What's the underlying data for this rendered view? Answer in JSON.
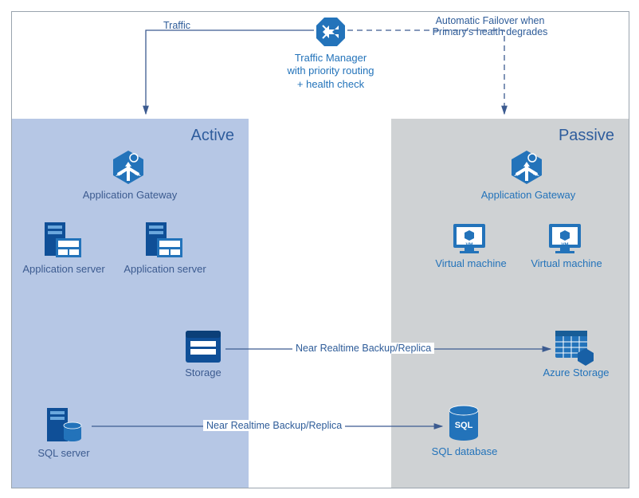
{
  "traffic_manager": {
    "label": "Traffic Manager with priority routing + health check"
  },
  "edges": {
    "traffic": "Traffic",
    "failover": "Automatic Failover when Primary's health degrades",
    "backup1": "Near Realtime Backup/Replica",
    "backup2": "Near Realtime Backup/Replica"
  },
  "active": {
    "title": "Active",
    "app_gateway": "Application Gateway",
    "server1": "Application server",
    "server2": "Application server",
    "storage": "Storage",
    "sql": "SQL server"
  },
  "passive": {
    "title": "Passive",
    "app_gateway": "Application Gateway",
    "vm1": "Virtual machine",
    "vm2": "Virtual machine",
    "storage": "Azure Storage",
    "sql": "SQL database"
  },
  "colors": {
    "azure_blue": "#2373ba",
    "line_blue": "#3c5b90"
  }
}
